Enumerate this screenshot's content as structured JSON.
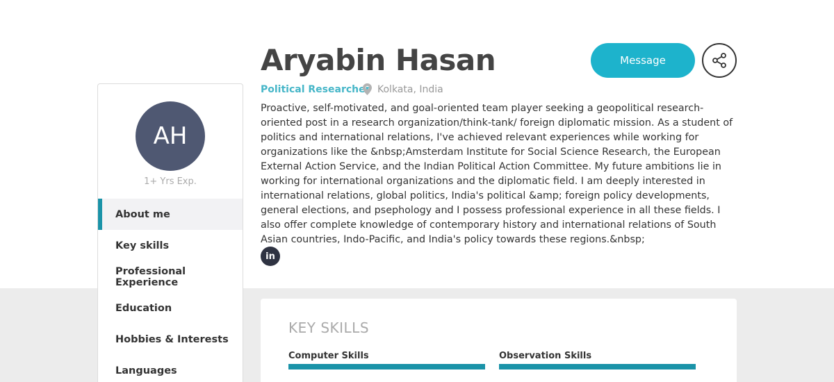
{
  "profile": {
    "initials": "AH",
    "experience": "1+ Yrs Exp.",
    "name": "Aryabin Hasan",
    "role": "Political Researcher",
    "location": "Kolkata, India",
    "about": "Proactive, self-motivated, and goal-oriented team player seeking a geopolitical research-oriented post in a research organization/think-tank/ foreign diplomatic mission. As a student of politics and international relations, I've achieved relevant experiences while working for organizations like the &nbsp;Amsterdam Institute for Social Science Research, the European External Action Service, and the Indian Political Action Committee. My future ambitions lie in working for international organizations and the diplomatic field. I am deeply interested in international relations, global politics, India's political &amp; foreign policy developments, general elections, and psephology and I possess professional experience in all these fields. I also offer complete knowledge of contemporary history and international relations of South Asian countries, Indo-Pacific, and India's policy towards these regions.&nbsp;",
    "avatar_color": "#4f5872"
  },
  "actions": {
    "message_label": "Message",
    "share_icon": "share-icon",
    "linkedin_label": "in"
  },
  "sidebar": {
    "items": [
      {
        "label": "About me",
        "active": true
      },
      {
        "label": "Key skills"
      },
      {
        "label": "Professional Experience"
      },
      {
        "label": "Education"
      },
      {
        "label": "Hobbies & Interests"
      },
      {
        "label": "Languages"
      }
    ]
  },
  "skills": {
    "title": "KEY SKILLS",
    "items": [
      {
        "label": "Computer Skills",
        "level": 1.0
      },
      {
        "label": "Observation Skills",
        "level": 1.0
      }
    ]
  },
  "colors": {
    "accent": "#1db3cc",
    "nav_accent": "#1a93a8",
    "role": "#46b6c8"
  }
}
